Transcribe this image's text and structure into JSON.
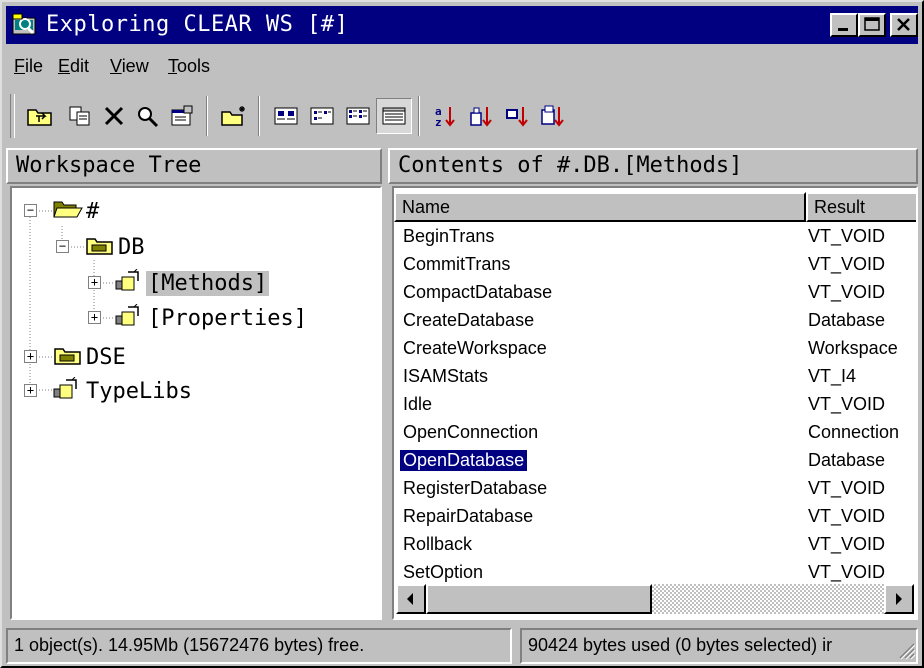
{
  "window": {
    "title": "Exploring CLEAR WS [#]",
    "buttons": [
      "minimize",
      "maximize",
      "close"
    ]
  },
  "menu": [
    {
      "label": "File",
      "accel": "F",
      "rest": "ile"
    },
    {
      "label": "Edit",
      "accel": "E",
      "rest": "dit"
    },
    {
      "label": "View",
      "accel": "V",
      "rest": "iew"
    },
    {
      "label": "Tools",
      "accel": "T",
      "rest": "ools"
    }
  ],
  "toolbar": {
    "icons": [
      "up-folder-icon",
      "copy-icon",
      "delete-icon",
      "find-icon",
      "properties-icon",
      "new-item-icon",
      "large-icons-icon",
      "small-icons-icon",
      "list-view-icon",
      "details-view-icon",
      "sort-by-name-icon",
      "sort-by-type-icon",
      "sort-by-size-icon",
      "sort-by-date-icon"
    ]
  },
  "tree_pane": {
    "header": "Workspace Tree",
    "nodes": [
      {
        "label": "#",
        "icon": "open-folder-icon",
        "expander": "−"
      },
      {
        "label": "DB",
        "icon": "folder-icon",
        "expander": "−"
      },
      {
        "label": "[Methods]",
        "icon": "collection-icon",
        "expander": "+",
        "selected": true
      },
      {
        "label": "[Properties]",
        "icon": "collection-icon",
        "expander": "+"
      },
      {
        "label": "DSE",
        "icon": "folder-icon",
        "expander": "+"
      },
      {
        "label": "TypeLibs",
        "icon": "collection-icon",
        "expander": "+"
      }
    ]
  },
  "list_pane": {
    "header": "Contents of #.DB.[Methods]",
    "columns": [
      "Name",
      "Result"
    ],
    "rows": [
      [
        "BeginTrans",
        "VT_VOID"
      ],
      [
        "CommitTrans",
        "VT_VOID"
      ],
      [
        "CompactDatabase",
        "VT_VOID"
      ],
      [
        "CreateDatabase",
        "Database"
      ],
      [
        "CreateWorkspace",
        "Workspace"
      ],
      [
        "ISAMStats",
        "VT_I4"
      ],
      [
        "Idle",
        "VT_VOID"
      ],
      [
        "OpenConnection",
        "Connection"
      ],
      [
        "OpenDatabase",
        "Database"
      ],
      [
        "RegisterDatabase",
        "VT_VOID"
      ],
      [
        "RepairDatabase",
        "VT_VOID"
      ],
      [
        "Rollback",
        "VT_VOID"
      ],
      [
        "SetOption",
        "VT_VOID"
      ]
    ],
    "selected_row": "OpenDatabase"
  },
  "statusbar": {
    "left": "1 object(s). 14.95Mb (15672476 bytes) free.",
    "right": "90424 bytes used (0 bytes selected) ir"
  },
  "colors": {
    "title_bg": "#000080",
    "face": "#c0c0c0",
    "selection": "#000080"
  }
}
